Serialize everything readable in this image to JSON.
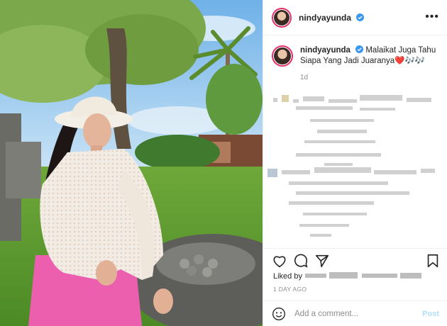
{
  "post": {
    "username": "nindyayunda",
    "verified_icon": "verified-badge-icon",
    "more_label": "•••",
    "caption": "Malaikat Juga Tahu Siapa Yang Jadi Juaranya❤️🎶🎶",
    "caption_time": "1d",
    "liked_prefix": "Liked by",
    "date": "1 DAY AGO"
  },
  "actions": {
    "like_icon": "heart-icon",
    "comment_icon": "comment-icon",
    "share_icon": "share-icon",
    "save_icon": "bookmark-icon"
  },
  "comment": {
    "placeholder": "Add a comment...",
    "post_label": "Post",
    "emoji_icon": "emoji-icon"
  },
  "colors": {
    "brand_ring": "#e1306c",
    "verified": "#3897f0",
    "post_disabled": "#b2dffc",
    "secondary_text": "#8e8e8e"
  }
}
